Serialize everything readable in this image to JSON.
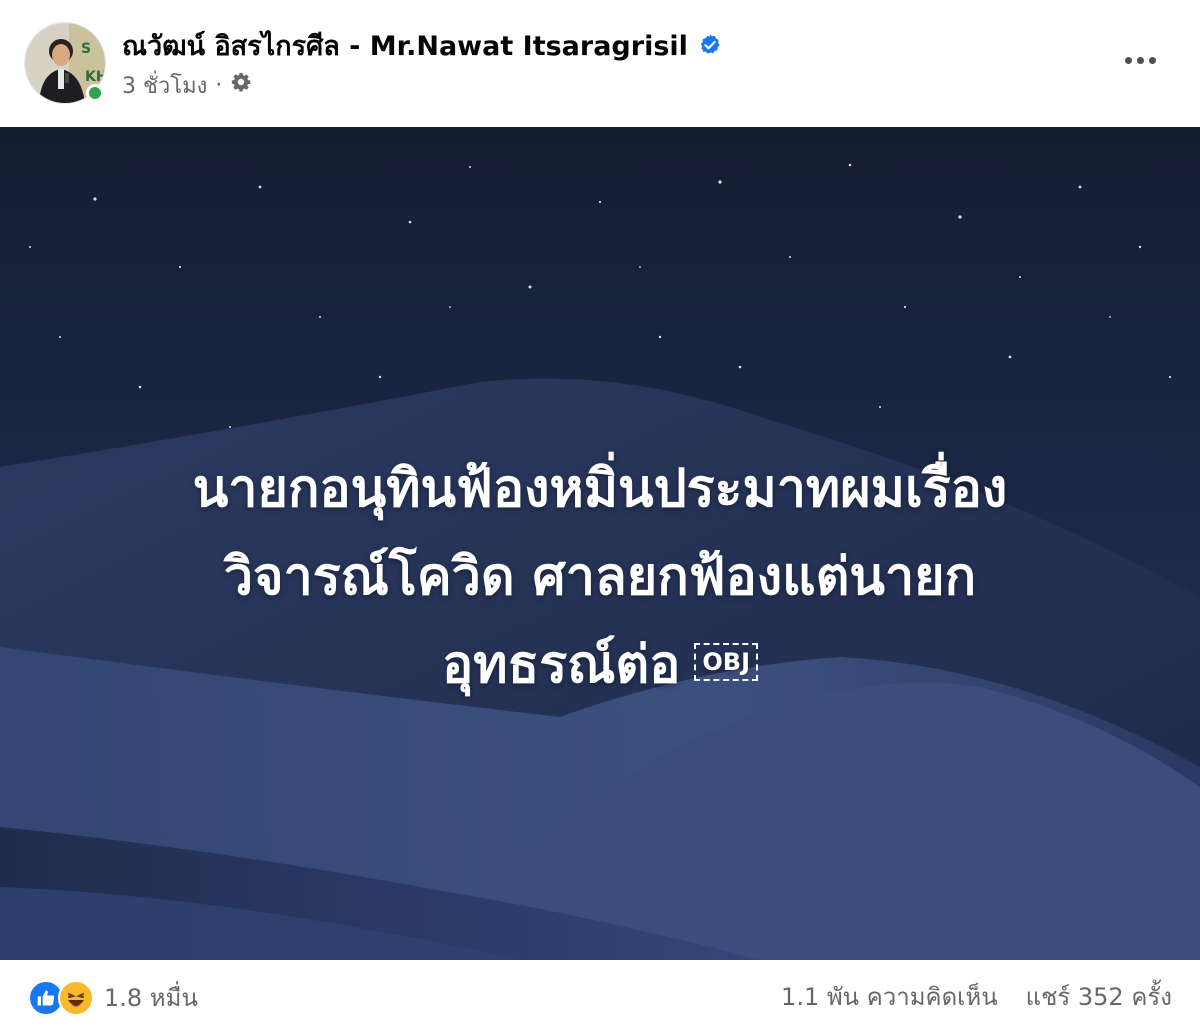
{
  "post": {
    "author_name": "ณวัฒน์ อิสรไกรศีล - Mr.Nawat Itsaragrisil",
    "timestamp": "3 ชั่วโมง",
    "separator": "·",
    "icons": {
      "verified": "verified-badge-icon",
      "privacy": "gear-icon",
      "more": "more-options-icon"
    }
  },
  "image": {
    "lines": [
      "นายกอนุทินฟ้องหมิ่นประมาทผมเรื่อง",
      "วิจารณ์โควิด ศาลยกฟ้องแต่นายก",
      "อุทธรณ์ต่อ"
    ],
    "obj_placeholder": "OBJ"
  },
  "footer": {
    "reaction_count": "1.8 หมื่น",
    "reaction_icons": [
      "like-reaction-icon",
      "haha-reaction-icon"
    ],
    "comments": "1.1 พัน ความคิดเห็น",
    "shares": "แชร์ 352 ครั้ง"
  },
  "colors": {
    "verified_blue": "#1877f2",
    "online_green": "#31a24c",
    "secondary_text": "#65676b",
    "like_blue": "#1877f2",
    "haha_yellow": "#f7b928"
  }
}
